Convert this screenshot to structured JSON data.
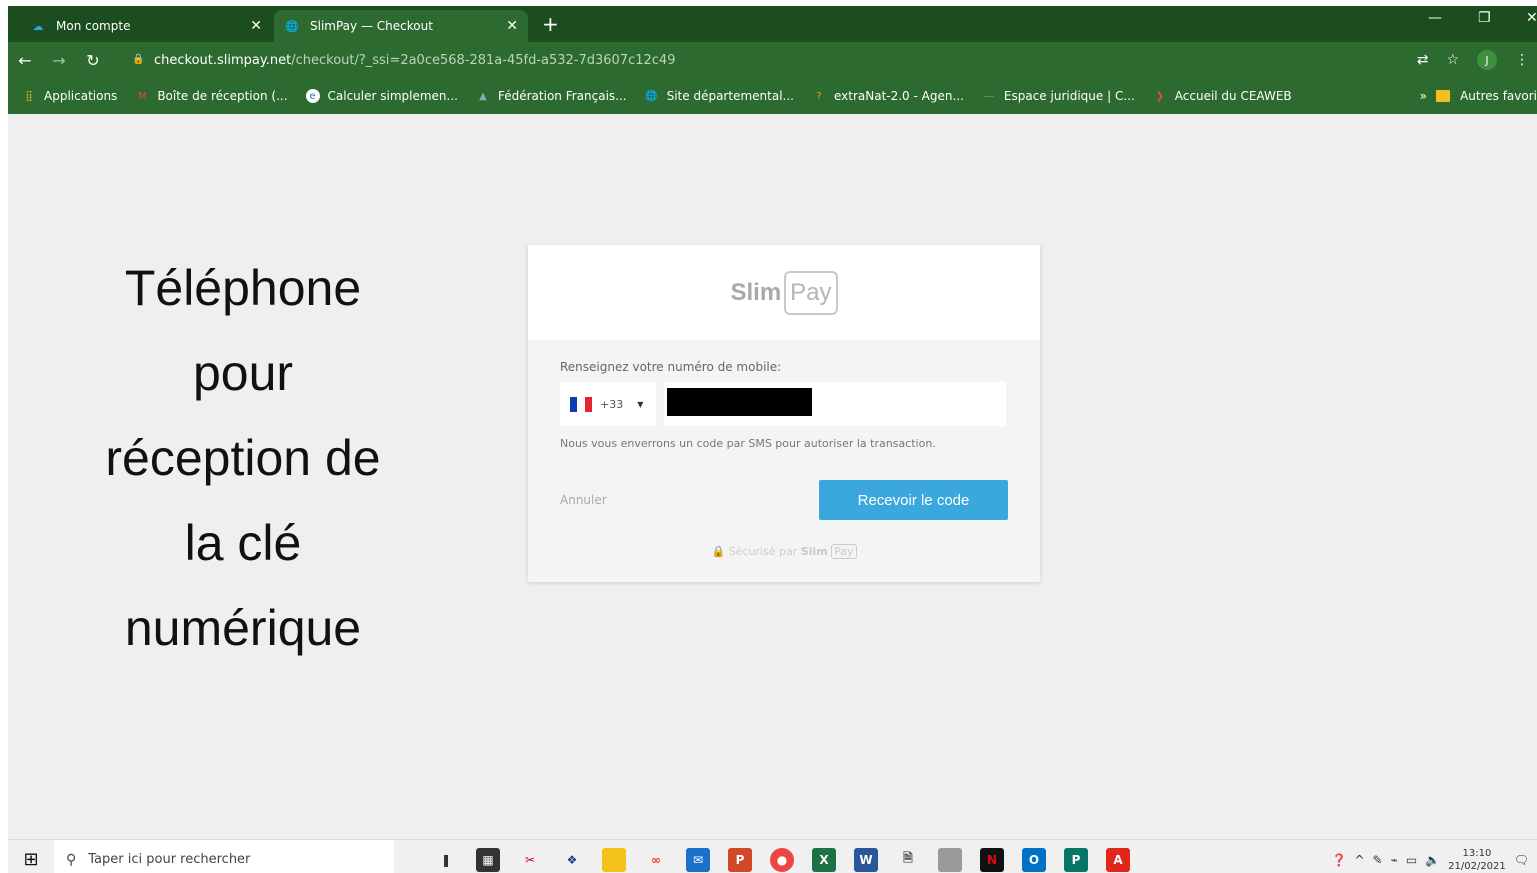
{
  "browser": {
    "tabs": [
      {
        "title": "Mon compte",
        "active": false
      },
      {
        "title": "SlimPay — Checkout",
        "active": true
      }
    ],
    "url_host": "checkout.slimpay.net",
    "url_path": "/checkout/?_ssi=2a0ce568-281a-45fd-a532-7d3607c12c49",
    "profile_initial": "J",
    "bookmarks": [
      "Applications",
      "Boîte de réception (...",
      "Calculer simplemen...",
      "Fédération Français...",
      "Site départemental...",
      "extraNat-2.0 - Agen...",
      "Espace juridique | C...",
      "Accueil du CEAWEB"
    ],
    "bookmarks_more": "»",
    "other_bookmarks": "Autres favori"
  },
  "caption": {
    "lines": [
      "Téléphone",
      "pour",
      "réception de",
      "la clé",
      "numérique"
    ]
  },
  "checkout": {
    "logo_slim": "Slim",
    "logo_pay": "Pay",
    "label": "Renseignez votre numéro de mobile:",
    "country_code": "+33",
    "hint": "Nous vous enverrons un code par SMS pour autoriser la transaction.",
    "cancel_label": "Annuler",
    "submit_label": "Recevoir le code",
    "secured_text": "Sécurisé par",
    "colors": {
      "button": "#3aa8dd"
    }
  },
  "taskbar": {
    "search_placeholder": "Taper ici pour rechercher",
    "time": "13:10",
    "date": "21/02/2021"
  }
}
